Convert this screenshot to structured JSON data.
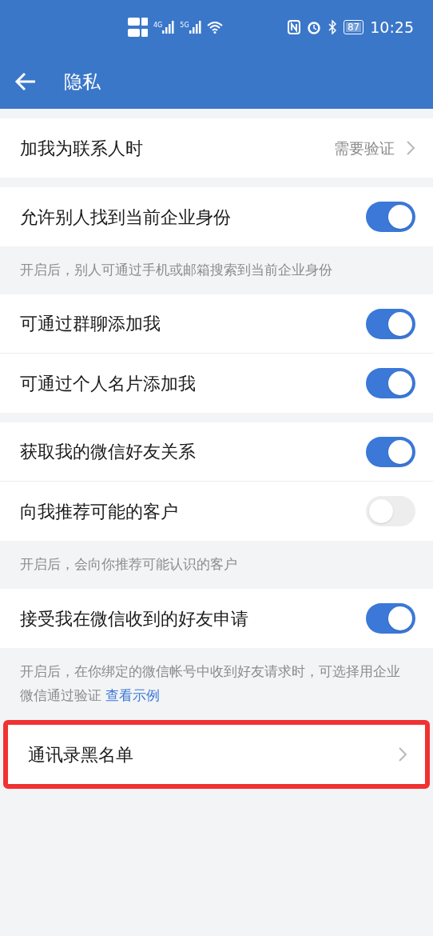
{
  "status_bar": {
    "networks": [
      "4G",
      "5G"
    ],
    "battery": "87",
    "time": "10:25"
  },
  "header": {
    "title": "隐私"
  },
  "groups": [
    {
      "rows": [
        {
          "kind": "link",
          "label": "加我为联系人时",
          "value": "需要验证",
          "highlighted": false
        }
      ]
    },
    {
      "rows": [
        {
          "kind": "toggle",
          "label": "允许别人找到当前企业身份",
          "on": true
        }
      ],
      "note": {
        "text": "开启后，别人可通过手机或邮箱搜索到当前企业身份"
      }
    },
    {
      "rows": [
        {
          "kind": "toggle",
          "label": "可通过群聊添加我",
          "on": true
        },
        {
          "kind": "toggle",
          "label": "可通过个人名片添加我",
          "on": true
        }
      ]
    },
    {
      "rows": [
        {
          "kind": "toggle",
          "label": "获取我的微信好友关系",
          "on": true
        },
        {
          "kind": "toggle",
          "label": "向我推荐可能的客户",
          "on": false
        }
      ],
      "note": {
        "text": "开启后，会向你推荐可能认识的客户"
      }
    },
    {
      "rows": [
        {
          "kind": "toggle",
          "label": "接受我在微信收到的好友申请",
          "on": true
        }
      ],
      "note": {
        "text": "开启后，在你绑定的微信帐号中收到好友请求时，可选择用企业微信通过验证",
        "link": "查看示例"
      }
    },
    {
      "rows": [
        {
          "kind": "link",
          "label": "通讯录黑名单",
          "highlighted": true
        }
      ]
    }
  ]
}
